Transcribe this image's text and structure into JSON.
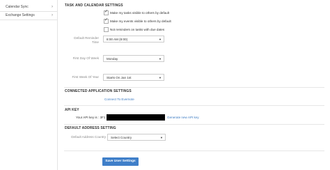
{
  "sidebar": {
    "items": [
      {
        "label": "Calendar Sync"
      },
      {
        "label": "Exchange Settings"
      }
    ]
  },
  "task_calendar": {
    "title": "TASK AND CALENDAR SETTINGS",
    "checkboxes": [
      {
        "label": "Make my tasks visible to others by default",
        "checked": true
      },
      {
        "label": "Make my events visible to others by default",
        "checked": true
      },
      {
        "label": "Not reminders on tasks with due dates",
        "checked": false
      }
    ],
    "default_reminder_label": "Default Reminder Time",
    "default_reminder_value": "8:00 AM (8:00)",
    "first_day_label": "First Day Of Week",
    "first_day_value": "Monday",
    "first_week_label": "First Week Of Year",
    "first_week_value": "Starts On Jan 1st"
  },
  "connected_apps": {
    "title": "CONNECTED APPLICATION SETTINGS",
    "link": "Connect To Evernote"
  },
  "api_key": {
    "title": "API KEY",
    "label": "Your API key is : 3F1",
    "generate_link": "Generate new API key"
  },
  "default_address": {
    "title": "DEFAULT ADDRESS SETTING",
    "label": "Default Address Country",
    "value": "Select Country"
  },
  "save_button": "Save User Settings",
  "colors": {
    "accent": "#3f7fc9",
    "link": "#3c7bc2"
  }
}
